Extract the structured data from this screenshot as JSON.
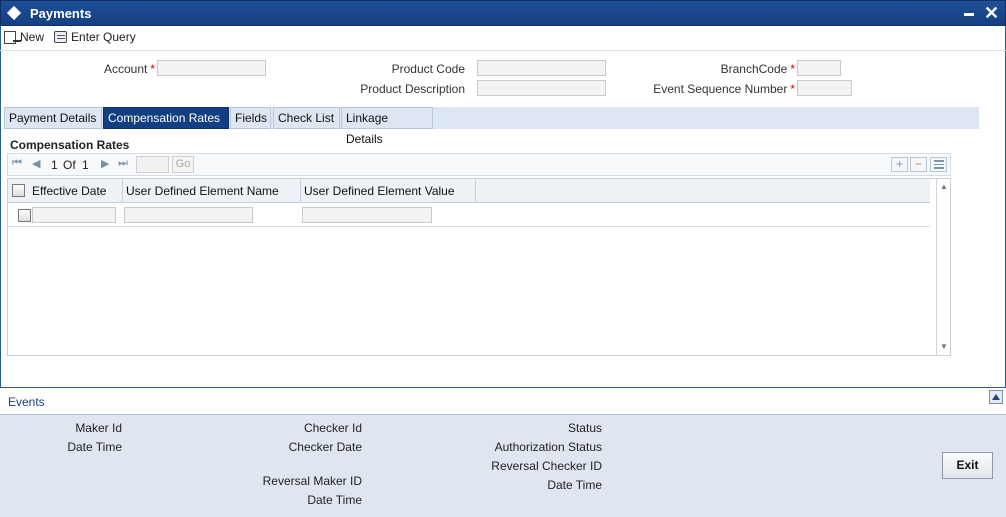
{
  "window": {
    "title": "Payments"
  },
  "toolbar": {
    "new_label": "New",
    "enter_query_label": "Enter Query"
  },
  "form": {
    "account_label": "Account",
    "product_code_label": "Product Code",
    "product_description_label": "Product Description",
    "branch_code_label": "BranchCode",
    "event_sequence_label": "Event Sequence Number",
    "required_marker": "*",
    "account_value": "",
    "product_code_value": "",
    "product_description_value": "",
    "branch_code_value": "",
    "event_sequence_value": ""
  },
  "tabs": [
    {
      "label": "Payment Details"
    },
    {
      "label": "Compensation Rates",
      "active": true
    },
    {
      "label": "Fields"
    },
    {
      "label": "Check List"
    },
    {
      "label": "Linkage Details"
    }
  ],
  "section": {
    "title": "Compensation Rates"
  },
  "pager": {
    "current": "1",
    "of_label": "Of",
    "total": "1",
    "go_label": "Go",
    "goto_value": ""
  },
  "grid": {
    "columns": [
      "Effective Date",
      "User Defined Element Name",
      "User Defined Element Value"
    ],
    "rows": [
      {
        "effective_date": "",
        "element_name": "",
        "element_value": ""
      }
    ]
  },
  "events": {
    "label": "Events"
  },
  "audit": {
    "maker_id": "Maker Id",
    "date_time_1": "Date Time",
    "checker_id": "Checker Id",
    "checker_date": "Checker Date",
    "reversal_maker_id": "Reversal Maker ID",
    "date_time_2": "Date Time",
    "status": "Status",
    "authorization_status": "Authorization Status",
    "reversal_checker_id": "Reversal Checker ID",
    "date_time_3": "Date Time"
  },
  "buttons": {
    "exit_label": "Exit"
  },
  "colors": {
    "title_bar": "#163f82",
    "active_tab": "#123e82",
    "footer": "#dfe6f0",
    "required": "#d00000"
  }
}
